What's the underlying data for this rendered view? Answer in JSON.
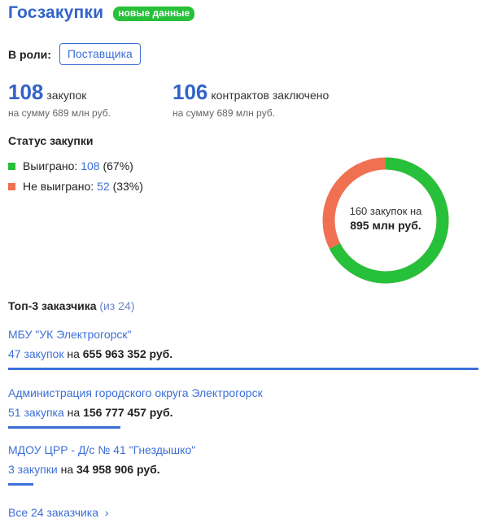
{
  "header": {
    "title": "Госзакупки",
    "badge": "новые данные"
  },
  "role": {
    "label": "В роли:",
    "button": "Поставщика"
  },
  "stats": {
    "purchases": {
      "number": "108",
      "label": "закупок",
      "sub": "на сумму 689 млн руб."
    },
    "contracts": {
      "number": "106",
      "label": "контрактов заключено",
      "sub": "на сумму 689 млн руб."
    }
  },
  "status": {
    "title": "Статус закупки",
    "won": {
      "label": "Выиграно:",
      "count": "108",
      "pct": "(67%)",
      "color": "#27c03a"
    },
    "lost": {
      "label": "Не выиграно:",
      "count": "52",
      "pct": "(33%)",
      "color": "#f07152"
    }
  },
  "donut": {
    "line1": "160 закупок на",
    "line2": "895 млн руб.",
    "won_fraction": 0.675
  },
  "top": {
    "title": "Топ-3 заказчика",
    "count": "(из 24)",
    "customers": [
      {
        "name": "МБУ \"УК Электрогорск\"",
        "purchases": "47 закупок",
        "on": "на",
        "amount": "655 963 352 руб.",
        "bar_fraction": 1.0
      },
      {
        "name": "Администрация городского округа Электрогорск",
        "purchases": "51 закупка",
        "on": "на",
        "amount": "156 777 457 руб.",
        "bar_fraction": 0.239
      },
      {
        "name": "МДОУ ЦРР - Д/с № 41 \"Гнездышко\"",
        "purchases": "3 закупки",
        "on": "на",
        "amount": "34 958 906 руб.",
        "bar_fraction": 0.053
      }
    ],
    "all_link": "Все 24 заказчика",
    "all_chevron": "›"
  }
}
